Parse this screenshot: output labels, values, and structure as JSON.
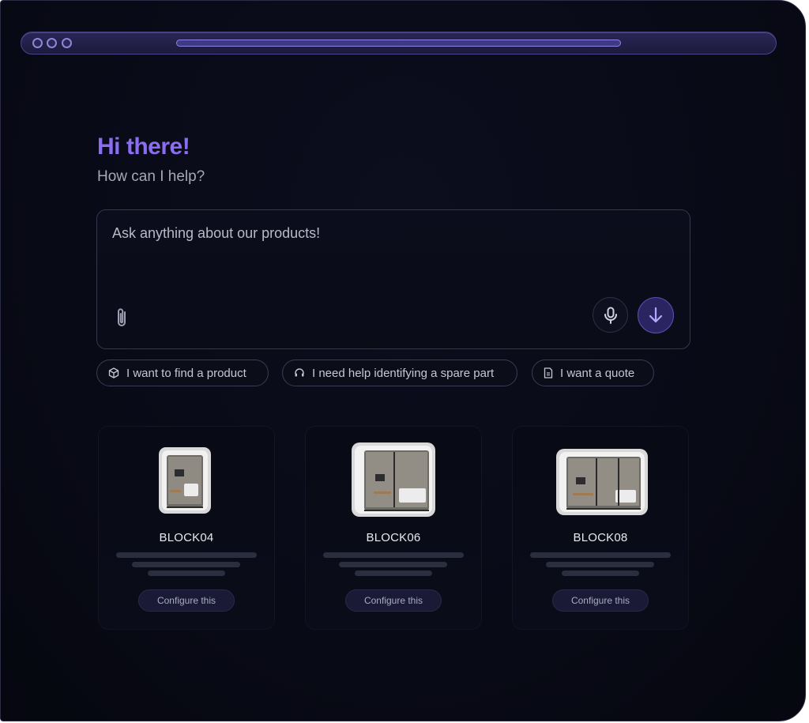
{
  "greeting": {
    "title": "Hi there!",
    "subtitle": "How can I help?"
  },
  "prompt": {
    "placeholder": "Ask anything about our products!"
  },
  "chips": [
    {
      "label": "I want to find a product",
      "icon": "cube-icon"
    },
    {
      "label": "I need help identifying a spare part",
      "icon": "headset-icon"
    },
    {
      "label": "I want a quote",
      "icon": "document-icon"
    }
  ],
  "products": [
    {
      "name": "BLOCK04",
      "cta": "Configure this"
    },
    {
      "name": "BLOCK06",
      "cta": "Configure this"
    },
    {
      "name": "BLOCK08",
      "cta": "Configure this"
    }
  ],
  "colors": {
    "accent": "#8b6df0",
    "background": "#080a16",
    "send_button": "#2a2560"
  }
}
